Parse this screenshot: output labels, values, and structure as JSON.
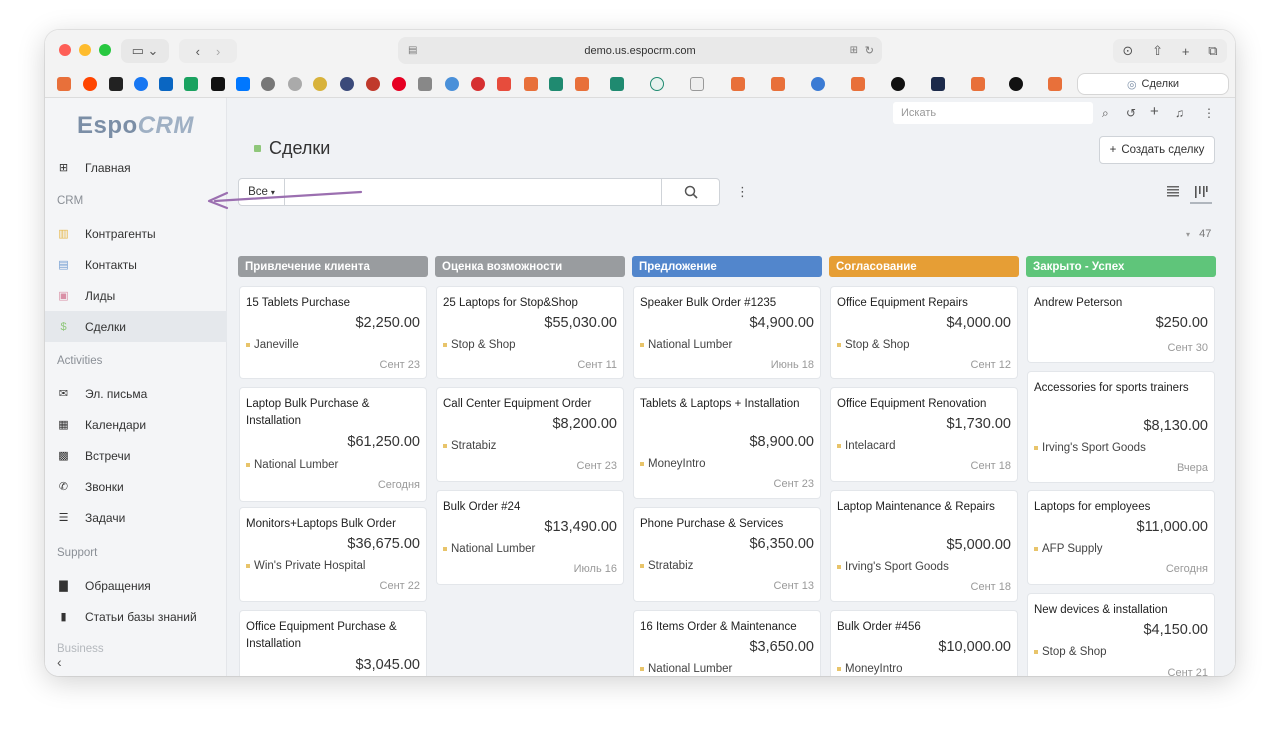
{
  "browser": {
    "url": "demo.us.espocrm.com",
    "active_tab": "Сделки"
  },
  "app": {
    "logo": {
      "espo": "Espo",
      "crm": "CRM"
    },
    "search_placeholder": "Искать"
  },
  "sidebar": {
    "home": "Главная",
    "sections": [
      {
        "title": "CRM",
        "items": [
          "Контрагенты",
          "Контакты",
          "Лиды",
          "Сделки"
        ]
      },
      {
        "title": "Activities",
        "items": [
          "Эл. письма",
          "Календари",
          "Встречи",
          "Звонки",
          "Задачи"
        ]
      },
      {
        "title": "Support",
        "items": [
          "Обращения",
          "Статьи базы знаний"
        ]
      },
      {
        "title": "Business",
        "items": []
      }
    ]
  },
  "page": {
    "title": "Сделки",
    "create_label": "Создать сделку",
    "filter_label": "Все",
    "total_count": "47"
  },
  "kanban": {
    "columns": [
      {
        "title": "Привлечение клиента",
        "color": "#999c9f",
        "cards": [
          {
            "name": "15 Tablets Purchase",
            "amount": "$2,250.00",
            "account": "Janeville",
            "date": "Сент 23"
          },
          {
            "name": "Laptop Bulk Purchase & Installation",
            "amount": "$61,250.00",
            "account": "National Lumber",
            "date": "Сегодня"
          },
          {
            "name": "Monitors+Laptops Bulk Order",
            "amount": "$36,675.00",
            "account": "Win's Private Hospital",
            "date": "Сент 22"
          },
          {
            "name": "Office Equipment Purchase & Installation",
            "amount": "$3,045.00",
            "account": "",
            "date": ""
          }
        ]
      },
      {
        "title": "Оценка возможности",
        "color": "#999c9f",
        "cards": [
          {
            "name": "25 Laptops for Stop&Shop",
            "amount": "$55,030.00",
            "account": "Stop & Shop",
            "date": "Сент 11"
          },
          {
            "name": "Call Center Equipment Order",
            "amount": "$8,200.00",
            "account": "Stratabiz",
            "date": "Сент 23"
          },
          {
            "name": "Bulk Order #24",
            "amount": "$13,490.00",
            "account": "National Lumber",
            "date": "Июль 16"
          }
        ]
      },
      {
        "title": "Предложение",
        "color": "#5286cc",
        "cards": [
          {
            "name": "Speaker Bulk Order #1235",
            "amount": "$4,900.00",
            "account": "National Lumber",
            "date": "Июнь 18"
          },
          {
            "name": "Tablets & Laptops + Installation",
            "amount": "$8,900.00",
            "account": "MoneyIntro",
            "date": "Сент 23"
          },
          {
            "name": "Phone Purchase & Services",
            "amount": "$6,350.00",
            "account": "Stratabiz",
            "date": "Сент 13"
          },
          {
            "name": "16 Items Order & Maintenance",
            "amount": "$3,650.00",
            "account": "National Lumber",
            "date": ""
          }
        ]
      },
      {
        "title": "Согласование",
        "color": "#e69e35",
        "cards": [
          {
            "name": "Office Equipment Repairs",
            "amount": "$4,000.00",
            "account": "Stop & Shop",
            "date": "Сент 12"
          },
          {
            "name": "Office Equipment Renovation",
            "amount": "$1,730.00",
            "account": "Intelacard",
            "date": "Сент 18"
          },
          {
            "name": "Laptop Maintenance & Repairs",
            "amount": "$5,000.00",
            "account": "Irving's Sport Goods",
            "date": "Сент 18"
          },
          {
            "name": "Bulk Order #456",
            "amount": "$10,000.00",
            "account": "MoneyIntro",
            "date": ""
          }
        ]
      },
      {
        "title": "Закрыто - Успех",
        "color": "#5fc57a",
        "cards": [
          {
            "name": "Andrew Peterson",
            "amount": "$250.00",
            "account": "",
            "date": "Сент 30"
          },
          {
            "name": "Accessories for sports trainers",
            "amount": "$8,130.00",
            "account": "Irving's Sport Goods",
            "date": "Вчера"
          },
          {
            "name": "Laptops for employees",
            "amount": "$11,000.00",
            "account": "AFP Supply",
            "date": "Сегодня"
          },
          {
            "name": "New devices & installation",
            "amount": "$4,150.00",
            "account": "Stop & Shop",
            "date": "Сент 21"
          }
        ]
      }
    ]
  }
}
